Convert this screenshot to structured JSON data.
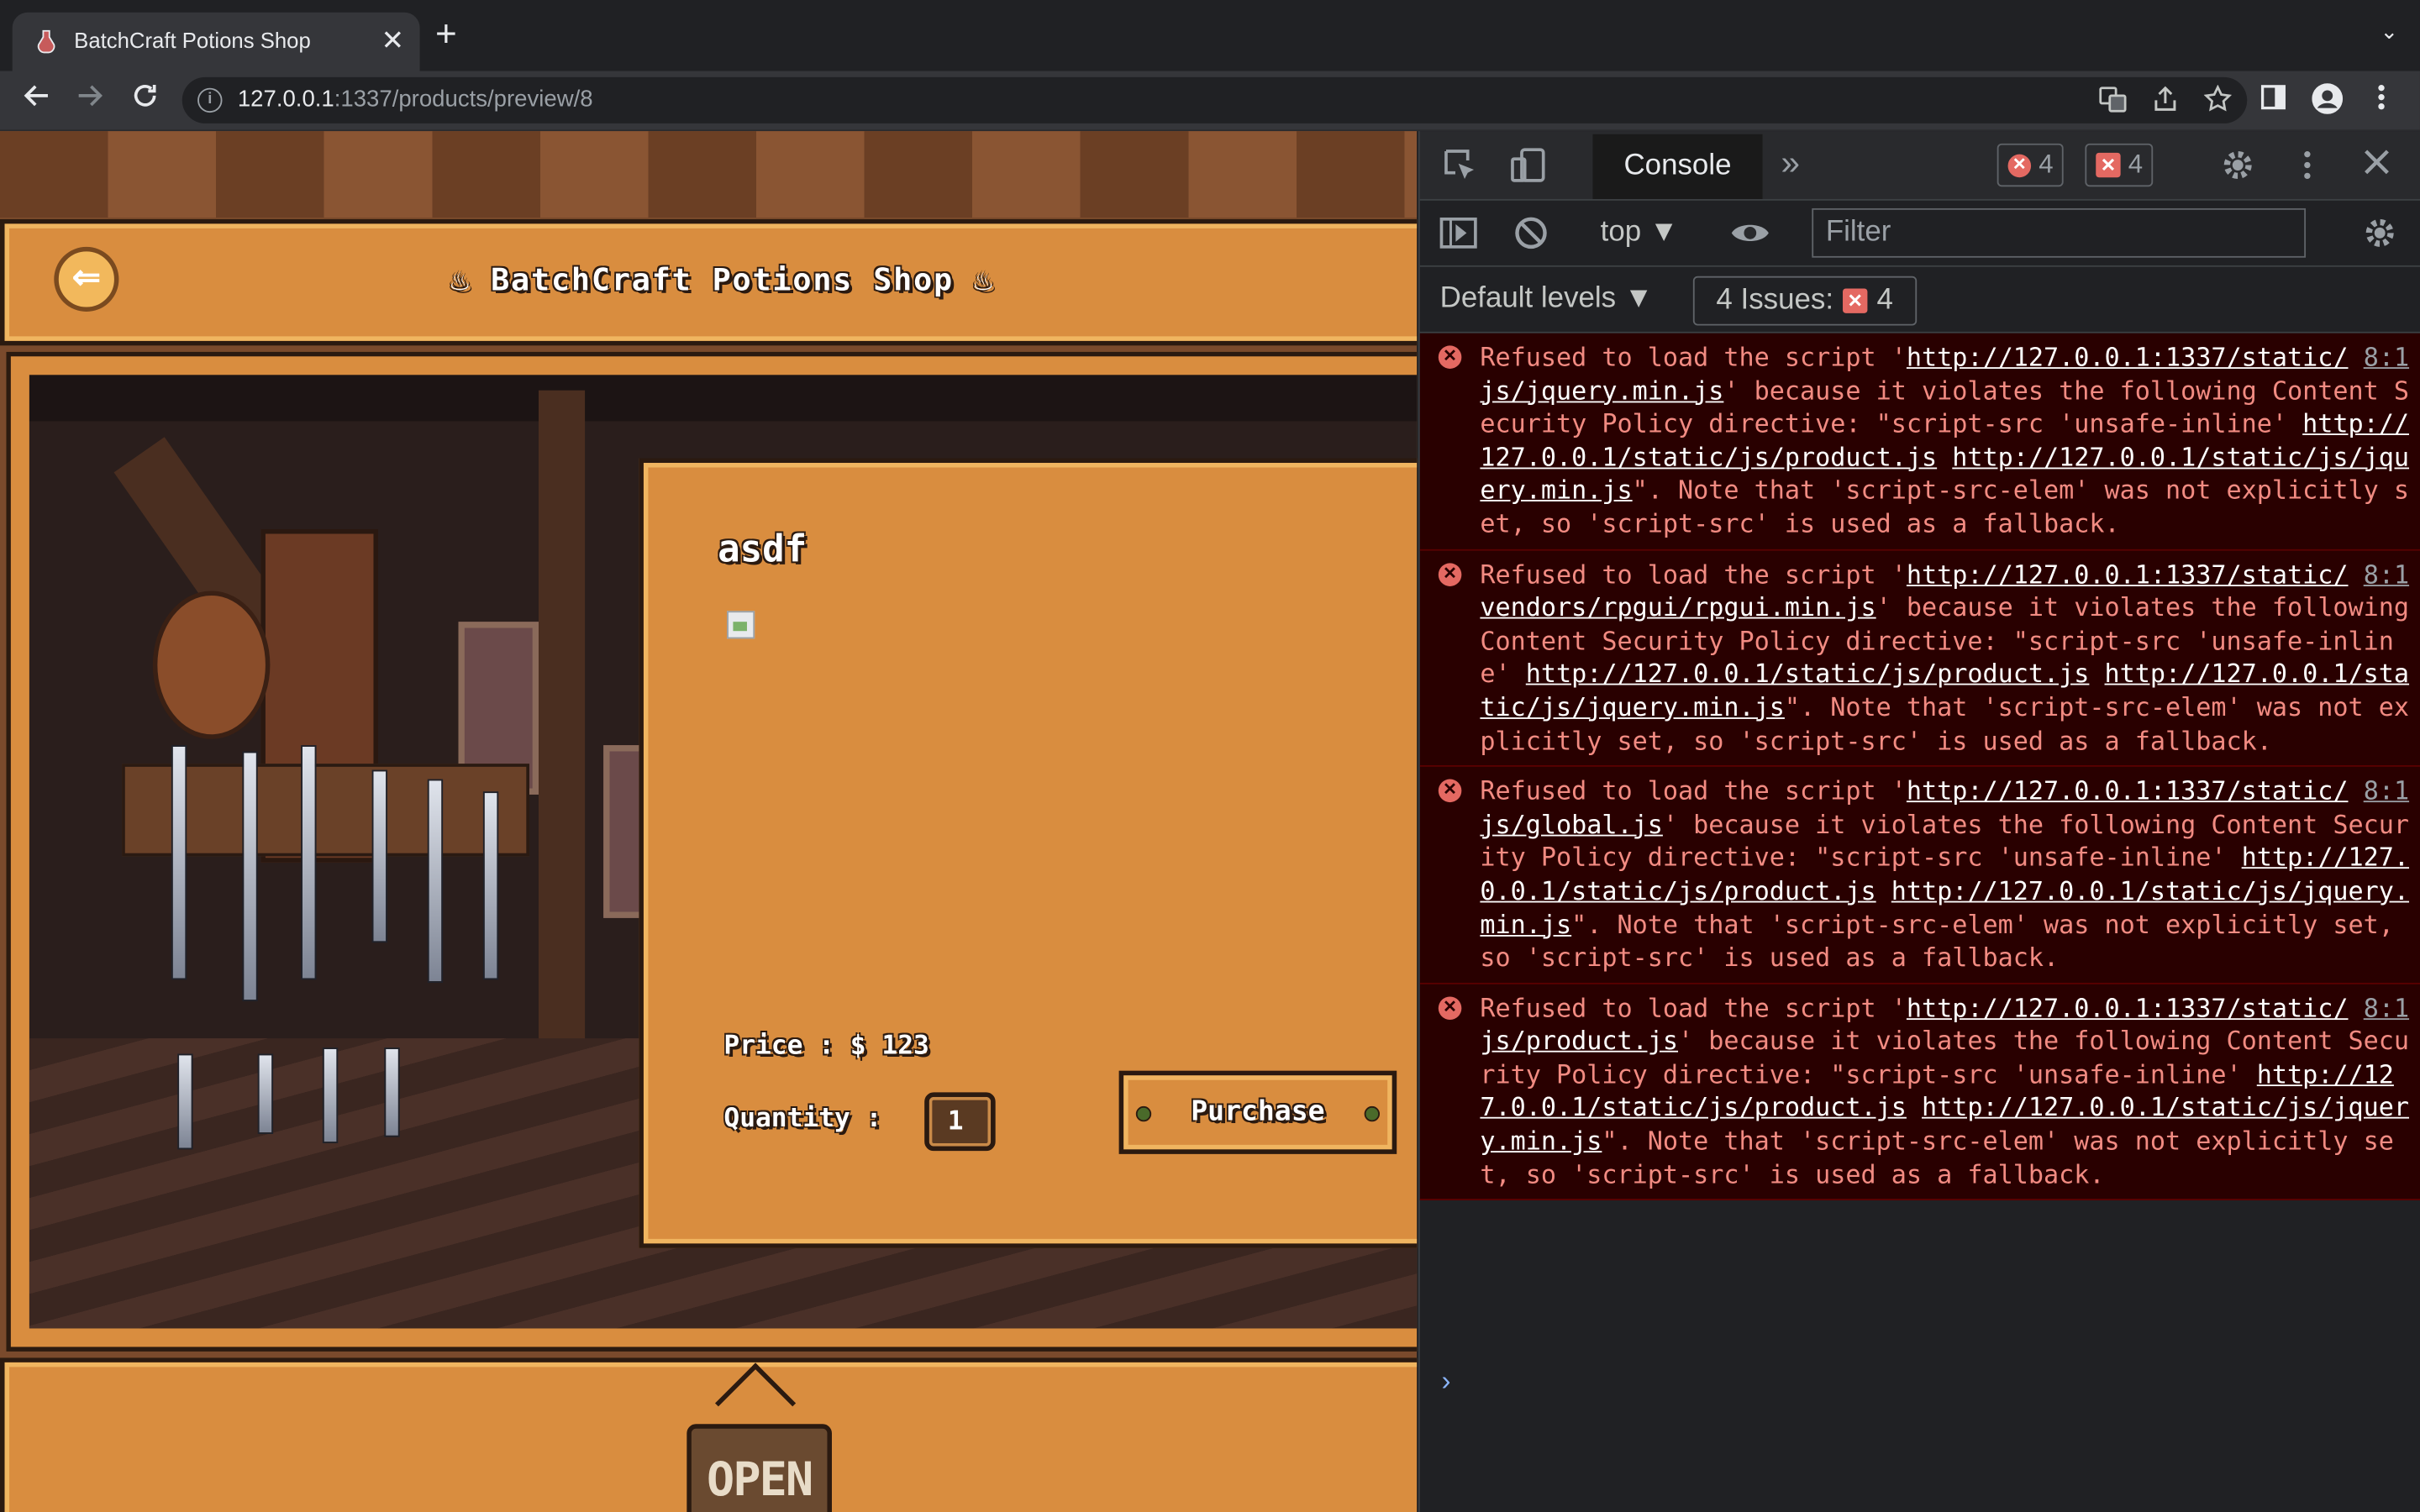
{
  "browser": {
    "tab_title": "BatchCraft Potions Shop",
    "tab_close": "✕",
    "new_tab": "+",
    "tab_search": "⌄",
    "url_host": "127.0.0.1",
    "url_rest": ":1337/products/preview/8",
    "icons": [
      "back-icon",
      "forward-icon",
      "reload-icon",
      "info-icon",
      "translate-icon",
      "share-icon",
      "bookmark-star-icon",
      "side-panel-icon",
      "profile-icon",
      "menu-icon"
    ]
  },
  "page": {
    "shop_title": "BatchCraft Potions Shop",
    "flame_glyph": "♨",
    "back_glyph": "⇐",
    "product_name": "asdf",
    "price_label": "Price : $ 123",
    "quantity_label": "Quantity :",
    "quantity_value": "1",
    "purchase_label": "Purchase",
    "open_sign": "OPEN"
  },
  "devtools": {
    "tab_console": "Console",
    "more_tabs": "»",
    "error_count": "4",
    "issue_count": "4",
    "context": "top ▼",
    "filter_placeholder": "Filter",
    "levels": "Default levels ▼",
    "issues_label": "4 Issues:",
    "issues_count": "4",
    "prompt": "›",
    "messages": [
      {
        "prefix": "Refused to load the script '",
        "url": "http://127.0.0.1:1337/static/js/jquery.min.js",
        "mid": "' because it violates the following Content Security Policy directive: \"script-src 'unsafe-inline' ",
        "link1": "http://127.0.0.1/static/js/product.js",
        "link2": "http://127.0.0.1/static/js/jquery.min.js",
        "suffix": "\". Note that 'script-src-elem' was not explicitly set, so 'script-src' is used as a fallback.",
        "source": "8:1"
      },
      {
        "prefix": "Refused to load the script '",
        "url": "http://127.0.0.1:1337/static/vendors/rpgui/rpgui.min.js",
        "mid": "' because it violates the following Content Security Policy directive: \"script-src 'unsafe-inline' ",
        "link1": "http://127.0.0.1/static/js/product.js",
        "link2": "http://127.0.0.1/static/js/jquery.min.js",
        "suffix": "\". Note that 'script-src-elem' was not explicitly set, so 'script-src' is used as a fallback.",
        "source": "8:1"
      },
      {
        "prefix": "Refused to load the script '",
        "url": "http://127.0.0.1:1337/static/js/global.js",
        "mid": "' because it violates the following Content Security Policy directive: \"script-src 'unsafe-inline' ",
        "link1": "http://127.0.0.1/static/js/product.js",
        "link2": "http://127.0.0.1/static/js/jquery.min.js",
        "suffix": "\". Note that 'script-src-elem' was not explicitly set, so 'script-src' is used as a fallback.",
        "source": "8:1"
      },
      {
        "prefix": "Refused to load the script '",
        "url": "http://127.0.0.1:1337/static/js/product.js",
        "mid": "' because it violates the following Content Security Policy directive: \"script-src 'unsafe-inline' ",
        "link1": "http://127.0.0.1/static/js/product.js",
        "link2": "http://127.0.0.1/static/js/jquery.min.js",
        "suffix": "\". Note that 'script-src-elem' was not explicitly set, so 'script-src' is used as a fallback.",
        "source": "8:1"
      }
    ]
  }
}
